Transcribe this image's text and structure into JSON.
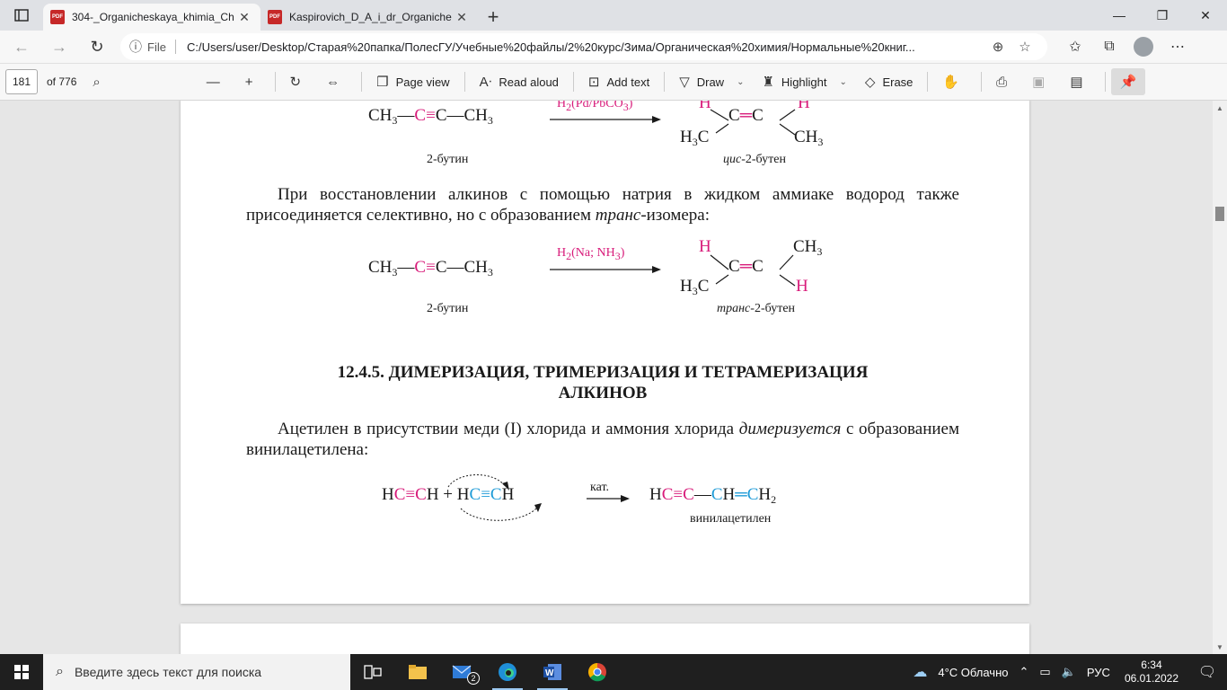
{
  "browser": {
    "tabs": [
      {
        "title": "304-_Organicheskaya_khimia_Ch",
        "active": true,
        "icon": "pdf-icon"
      },
      {
        "title": "Kaspirovich_D_A_i_dr_Organiche",
        "active": false,
        "icon": "pdf-icon"
      }
    ],
    "file_label": "File",
    "url": "C:/Users/user/Desktop/Старая%20папка/ПолесГУ/Учебные%20файлы/2%20курс/Зима/Органическая%20химия/Нормальные%20книг..."
  },
  "pdf_toolbar": {
    "page_number": "181",
    "page_total": "of 776",
    "page_view": "Page view",
    "read_aloud": "Read aloud",
    "add_text": "Add text",
    "draw": "Draw",
    "highlight": "Highlight",
    "erase": "Erase"
  },
  "document": {
    "eq1": {
      "reactant_left": "CH",
      "reactant_c1": "C",
      "reactant_c2": "C",
      "reactant_right": "CH",
      "reagent": "H",
      "reagent_rest": "(Pd/PbCO",
      "reagent_close": ")",
      "reactant_name": "2-бутин",
      "product_name_prefix": "цис",
      "product_name_rest": "-2-бутен"
    },
    "para1_a": "При восстановлении алкинов с помощью натрия в жидком аммиаке водород также присоединяется селективно, но с образованием ",
    "para1_italic": "транс",
    "para1_b": "-изомера:",
    "eq2": {
      "reagent": "H",
      "reagent_rest": "(Na; NH",
      "reagent_close": ")",
      "reactant_name": "2-бутин",
      "product_name_prefix": "транс",
      "product_name_rest": "-2-бутен"
    },
    "heading_line1": "12.4.5. ДИМЕРИЗАЦИЯ, ТРИМЕРИЗАЦИЯ И ТЕТРАМЕРИЗАЦИЯ",
    "heading_line2": "АЛКИНОВ",
    "para2_a": "Ацетилен в присутствии меди (I) хлорида и аммония хлорида ",
    "para2_italic": "димеризуется",
    "para2_b": " с образованием винилацетилена:",
    "eq3": {
      "catalyst": "кат.",
      "product_name": "винилацетилен"
    }
  },
  "taskbar": {
    "search_placeholder": "Введите здесь текст для поиска",
    "mail_badge": "2",
    "weather": "4°C  Облачно",
    "language": "РУС",
    "time": "6:34",
    "date": "06.01.2022"
  },
  "colors": {
    "accent_magenta": "#d81b7a",
    "accent_cyan": "#1e9bd7"
  }
}
